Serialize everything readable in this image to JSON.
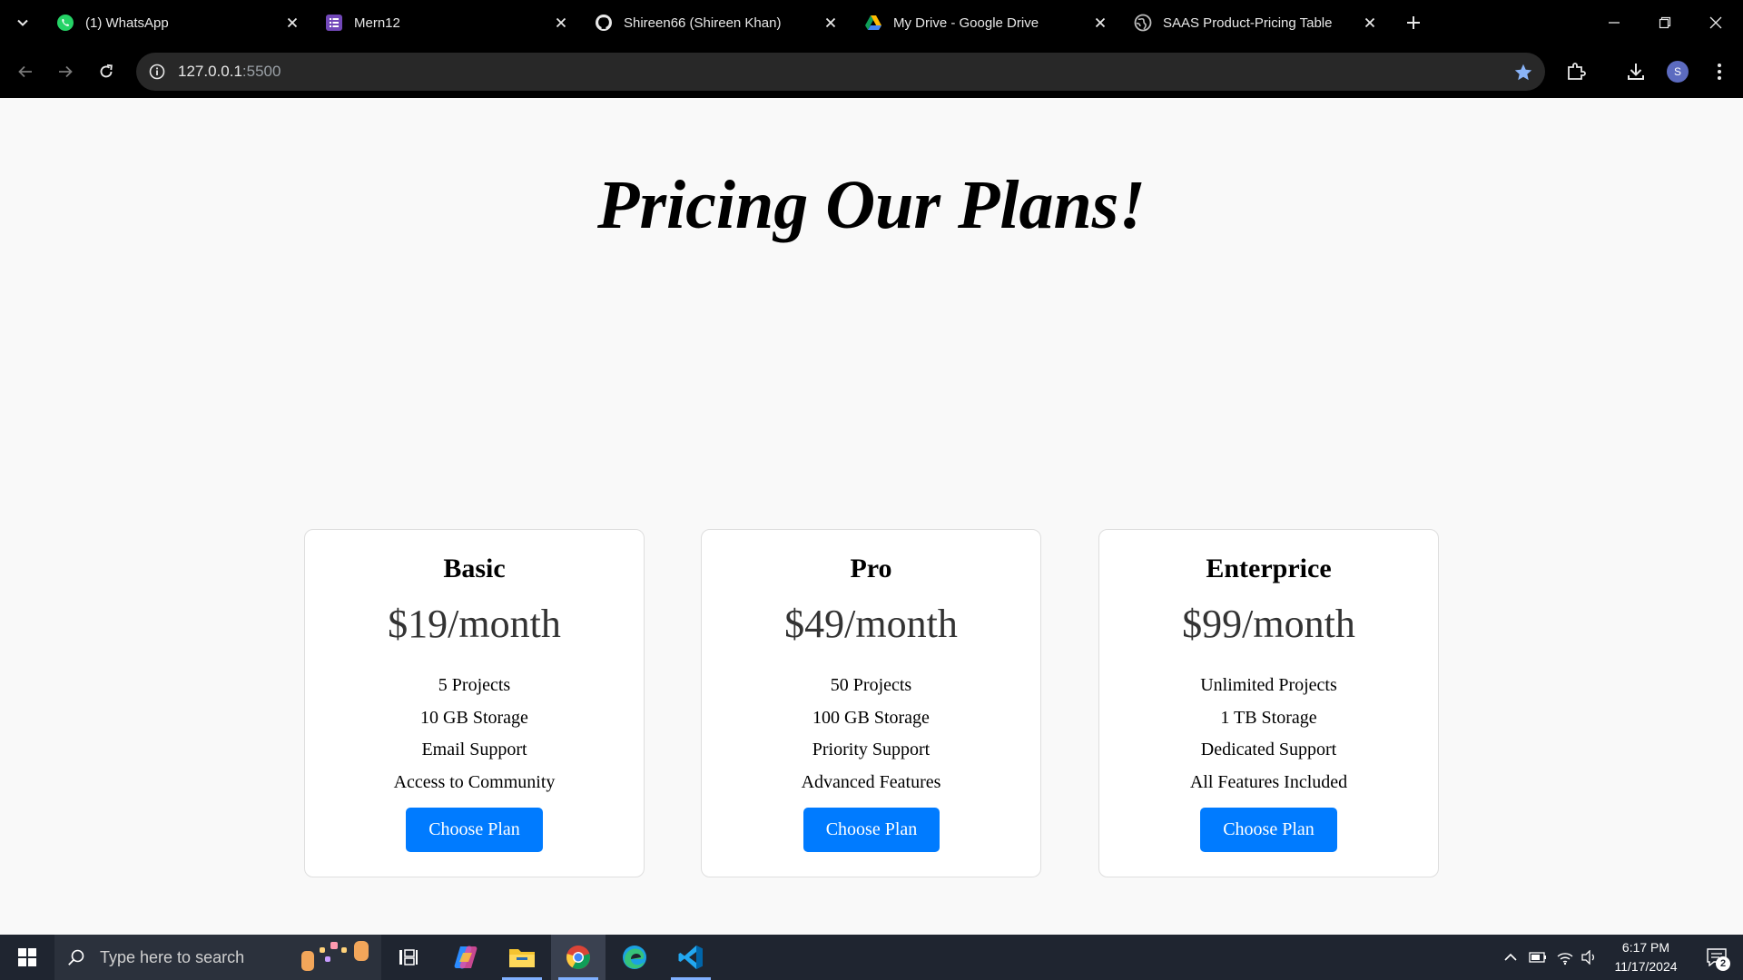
{
  "browser": {
    "tabs": [
      {
        "title": "(1) WhatsApp",
        "icon": "whatsapp-icon"
      },
      {
        "title": "Mern12",
        "icon": "forms-icon"
      },
      {
        "title": "Shireen66 (Shireen Khan)",
        "icon": "github-icon"
      },
      {
        "title": "My Drive - Google Drive",
        "icon": "google-drive-icon"
      },
      {
        "title": "SAAS Product-Pricing Table",
        "icon": "globe-icon"
      }
    ],
    "url_host": "127.0.0.1",
    "url_port": ":5500",
    "avatar_letter": "S",
    "accent": "#8ab4f8"
  },
  "page": {
    "heading": "Pricing Our Plans!",
    "plans": [
      {
        "name": "Basic",
        "price": "$19/month",
        "features": [
          "5 Projects",
          "10 GB Storage",
          "Email Support",
          "Access to Community"
        ],
        "button": "Choose Plan"
      },
      {
        "name": "Pro",
        "price": "$49/month",
        "features": [
          "50 Projects",
          "100 GB Storage",
          "Priority Support",
          "Advanced Features"
        ],
        "button": "Choose Plan"
      },
      {
        "name": "Enterprice",
        "price": "$99/month",
        "features": [
          "Unlimited Projects",
          "1 TB Storage",
          "Dedicated Support",
          "All Features Included"
        ],
        "button": "Choose Plan"
      }
    ],
    "button_color": "#007bff"
  },
  "taskbar": {
    "search_placeholder": "Type here to search",
    "time": "6:17 PM",
    "date": "11/17/2024",
    "notification_count": "2",
    "apps": [
      "task-view",
      "copilot",
      "file-explorer",
      "chrome",
      "edge",
      "vscode"
    ]
  }
}
